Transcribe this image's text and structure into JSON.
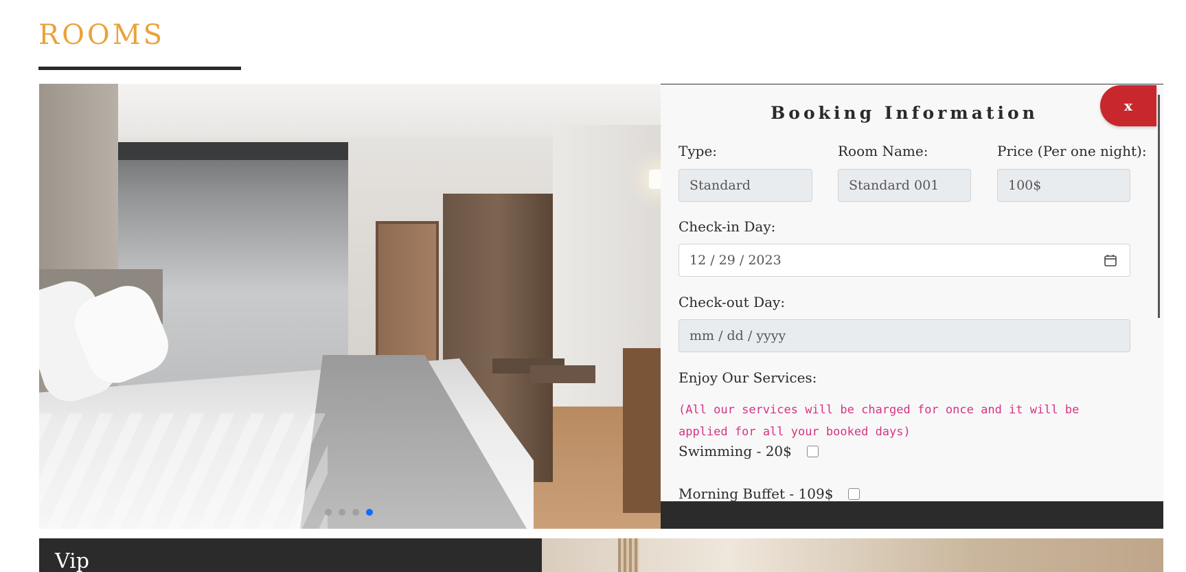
{
  "section": {
    "title": "ROOMS"
  },
  "carousel": {
    "slide_count": 4,
    "active_index": 3
  },
  "booking": {
    "title": "Booking Information",
    "close_label": "x",
    "type": {
      "label": "Type:",
      "value": "Standard"
    },
    "room_name": {
      "label": "Room Name:",
      "value": "Standard 001"
    },
    "price": {
      "label": "Price (Per one night):",
      "value": "100$"
    },
    "checkin": {
      "label": "Check-in Day:",
      "value": "12 / 29 / 2023"
    },
    "checkout": {
      "label": "Check-out Day:",
      "placeholder": "mm / dd / yyyy"
    },
    "services": {
      "label": "Enjoy Our Services:",
      "note": "(All our services will be charged for once and it will be applied for all your booked days)",
      "items": [
        {
          "label": "Swimming - 20$",
          "checked": false
        },
        {
          "label": "Morning Buffet - 109$",
          "checked": false
        }
      ]
    }
  },
  "next_room": {
    "label": "Vip"
  },
  "colors": {
    "accent": "#e9a23b",
    "close": "#c8272d",
    "note": "#d63384",
    "active_dot": "#0d6efd"
  }
}
